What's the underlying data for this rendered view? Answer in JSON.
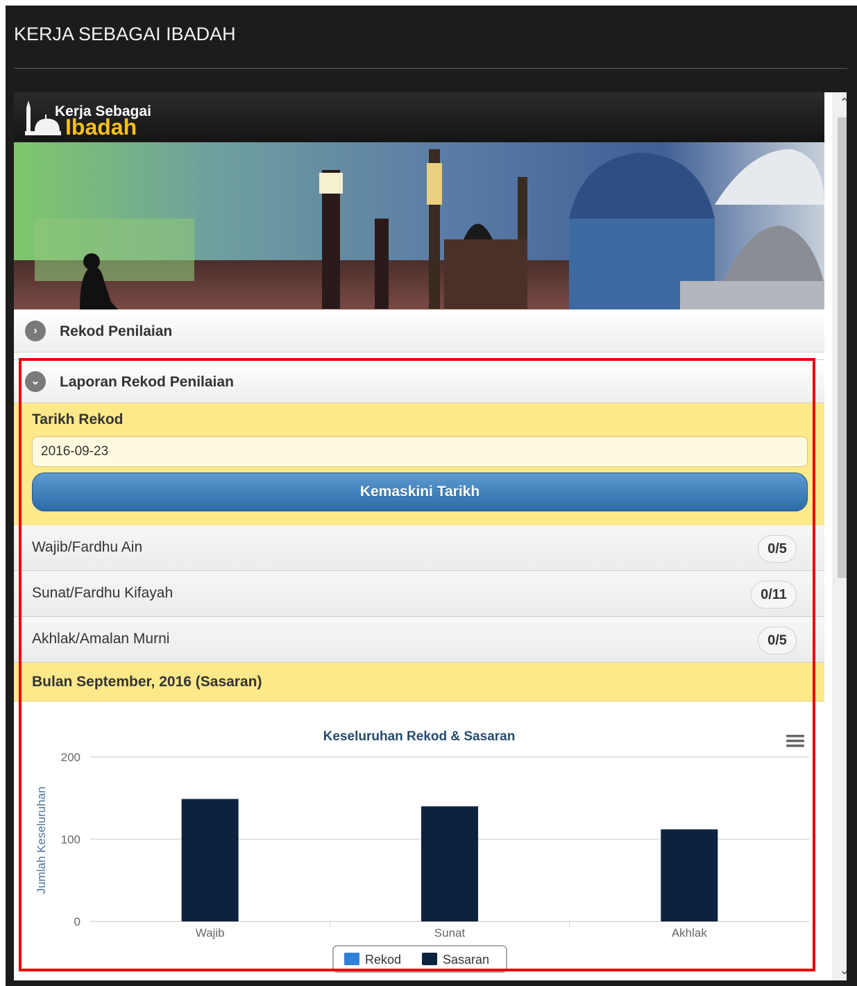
{
  "window": {
    "title": "KERJA SEBAGAI IBADAH"
  },
  "app": {
    "logo_line1": "Kerja Sebagai",
    "logo_line2": "Ibadah"
  },
  "sections": {
    "rekod_penilaian": "Rekod Penilaian",
    "laporan_rekod_penilaian": "Laporan Rekod Penilaian"
  },
  "form": {
    "date_label": "Tarikh Rekod",
    "date_value": "2016-09-23",
    "update_button": "Kemaskini Tarikh"
  },
  "categories": [
    {
      "label": "Wajib/Fardhu Ain",
      "count": "0/5"
    },
    {
      "label": "Sunat/Fardhu Kifayah",
      "count": "0/11"
    },
    {
      "label": "Akhlak/Amalan Murni",
      "count": "0/5"
    }
  ],
  "month_header": "Bulan September, 2016 (Sasaran)",
  "colors": {
    "accent_yellow": "#fde989",
    "button_blue": "#3a7ab8",
    "rekod": "#2f80d8",
    "sasaran": "#0c233f",
    "highlight": "#e8000b"
  },
  "icons": {
    "collapsed": "chevron-right-icon",
    "expanded": "chevron-down-icon",
    "chart_menu": "hamburger-menu-icon"
  },
  "chart_data": {
    "type": "bar",
    "title": "Keseluruhan Rekod & Sasaran",
    "xlabel": "",
    "ylabel": "Jumlah Keseluruhan",
    "categories": [
      "Wajib",
      "Sunat",
      "Akhlak"
    ],
    "ylim": [
      0,
      200
    ],
    "yticks": [
      0,
      100,
      200
    ],
    "grid": true,
    "legend_position": "bottom",
    "series": [
      {
        "name": "Rekod",
        "values": [
          0,
          0,
          0
        ],
        "color": "#2f80d8"
      },
      {
        "name": "Sasaran",
        "values": [
          149,
          140,
          112
        ],
        "color": "#0c233f"
      }
    ]
  }
}
